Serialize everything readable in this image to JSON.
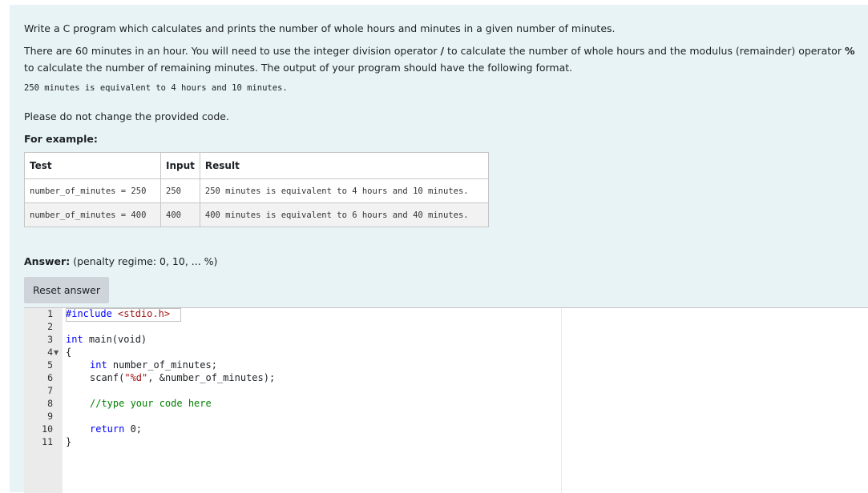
{
  "question": {
    "p1": "Write a C program which calculates and prints the number of whole hours and minutes in a given number of minutes.",
    "p2a": "There are 60 minutes in an hour. You will need to use the integer division operator ",
    "p2op1": "/",
    "p2b": " to calculate the number of whole hours and the modulus (remainder) operator ",
    "p2op2": "%",
    "p2c": " to calculate the number of remaining minutes. The output of your program should have the following format.",
    "format_line": "250 minutes is equivalent to 4 hours and 10 minutes.",
    "p4": "Please do not change the provided code.",
    "for_example": "For example:"
  },
  "examples": {
    "headers": [
      "Test",
      "Input",
      "Result"
    ],
    "rows": [
      {
        "test": "number_of_minutes = 250",
        "input": "250",
        "result": "250 minutes is equivalent to 4 hours and 10 minutes."
      },
      {
        "test": "number_of_minutes = 400",
        "input": "400",
        "result": "400 minutes is equivalent to 6 hours and 40 minutes."
      }
    ]
  },
  "answer": {
    "label": "Answer:",
    "penalty": "(penalty regime: 0, 10, ... %)",
    "reset_label": "Reset answer"
  },
  "editor": {
    "line_numbers": [
      "1",
      "2",
      "3",
      "4",
      "5",
      "6",
      "7",
      "8",
      "9",
      "10",
      "11"
    ],
    "l1_pp": "#include",
    "l1_inc": " <stdio.h>",
    "l3_kw": "int",
    "l3_rest": " main(void)",
    "l4": "{",
    "l5_kw": "int",
    "l5_rest": " number_of_minutes;",
    "l6_a": "scanf(",
    "l6_str": "\"%d\"",
    "l6_b": ", &number_of_minutes);",
    "l8": "//type your code here",
    "l10_kw": "return",
    "l10_rest": " 0;",
    "l11": "}"
  }
}
